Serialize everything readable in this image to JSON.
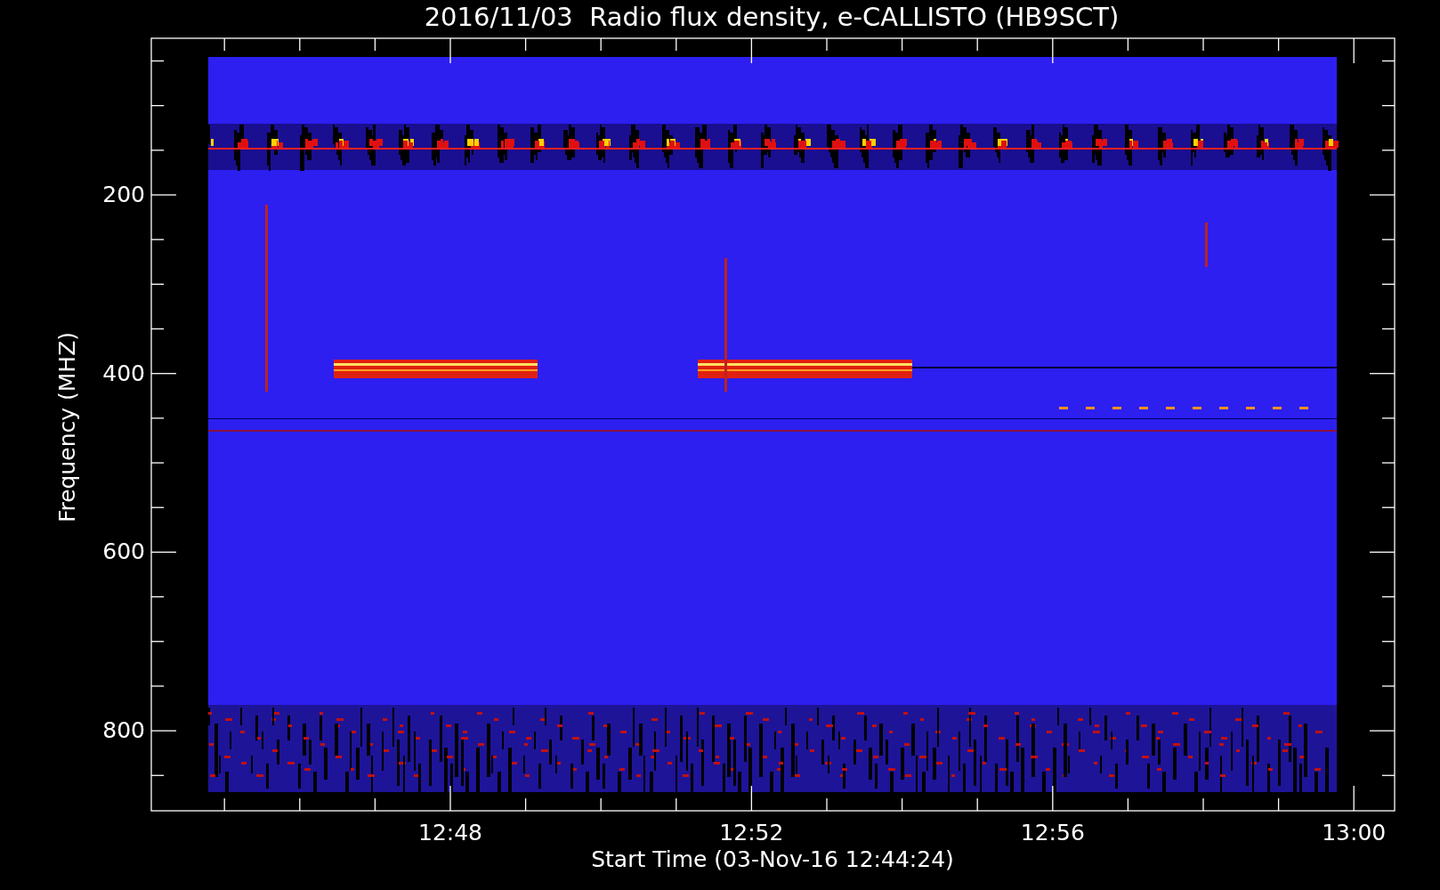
{
  "title": "2016/11/03  Radio flux density, e-CALLISTO (HB9SCT)",
  "y_axis": {
    "label": "Frequency (MHZ)",
    "ticks": [
      "200",
      "400",
      "600",
      "800"
    ]
  },
  "x_axis": {
    "label": "Start Time (03-Nov-16 12:44:24)",
    "ticks": [
      "12:48",
      "12:52",
      "12:56",
      "13:00"
    ]
  }
}
